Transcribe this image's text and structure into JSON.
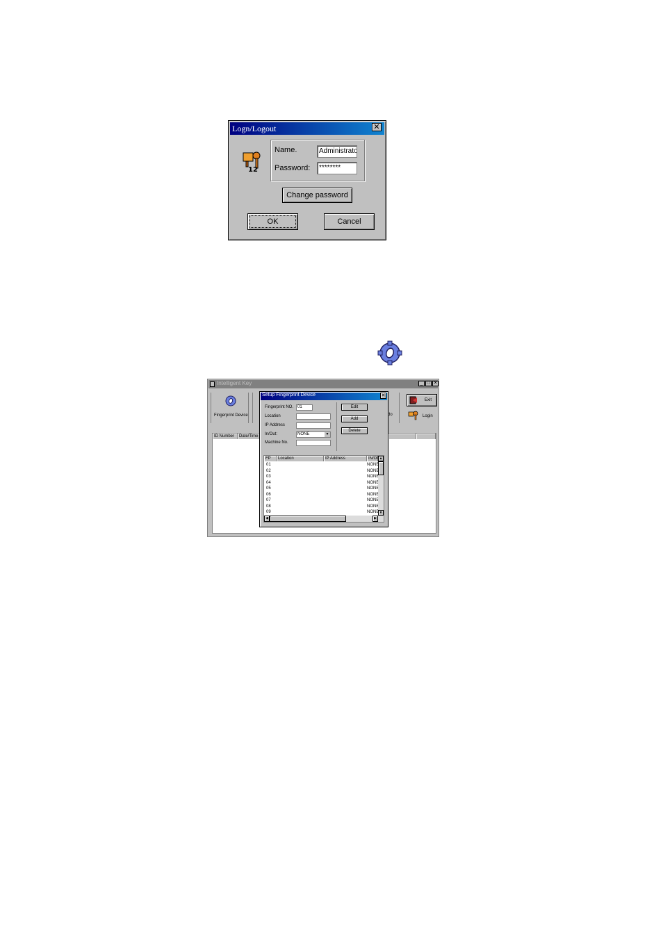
{
  "login": {
    "title": "Logn/Logout",
    "close": "✕",
    "name_label": "Name.",
    "name_value": "Administrator",
    "password_label": "Password:",
    "password_value": "********",
    "change_password": "Change password",
    "ok": "OK",
    "cancel": "Cancel"
  },
  "app": {
    "title": "Intelligent Key",
    "toolbar": {
      "fingerprint_device": "Fingerprint Device",
      "partial_label": "do",
      "exit": "Exit",
      "login": "Login"
    },
    "columns": [
      "ID Number",
      "Date/Time"
    ]
  },
  "setup": {
    "title": "Setup Fingerprint Device",
    "fields": {
      "fingerprint_no_label": "Fingerprint NO.",
      "fingerprint_no_value": "01",
      "location_label": "Location",
      "ip_label": "IP Address",
      "inout_label": "In/Out:",
      "inout_value": "NONE",
      "machine_label": "Machine No."
    },
    "buttons": {
      "edit": "Edit",
      "add": "Add",
      "delete": "Delete"
    },
    "table": {
      "headers": [
        "FP",
        "Location",
        "IP Address",
        "IN/OUT"
      ],
      "rows": [
        {
          "fp": "01",
          "inout": "NONE"
        },
        {
          "fp": "02",
          "inout": "NONE"
        },
        {
          "fp": "03",
          "inout": "NONE"
        },
        {
          "fp": "04",
          "inout": "NONE"
        },
        {
          "fp": "05",
          "inout": "NONE"
        },
        {
          "fp": "06",
          "inout": "NONE"
        },
        {
          "fp": "07",
          "inout": "NONE"
        },
        {
          "fp": "08",
          "inout": "NONE"
        },
        {
          "fp": "09",
          "inout": "NONE"
        }
      ]
    }
  },
  "colors": {
    "dialog_bg": "#c0c0c0",
    "titlebar_active": "#000080",
    "titlebar_inactive": "#808080",
    "gear": "#6a7fe0"
  }
}
